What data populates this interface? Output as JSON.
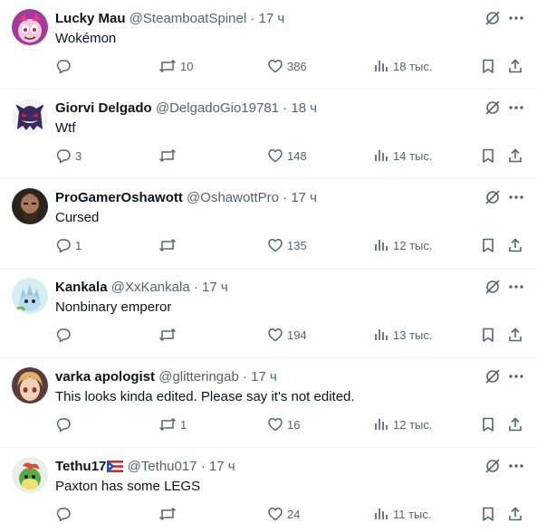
{
  "tweets": [
    {
      "name": "Lucky Mau",
      "handle": "@SteamboatSpinel",
      "sep": " · ",
      "time": "17 ч",
      "text": "Wokémon",
      "replies": "",
      "retweets": "10",
      "likes": "386",
      "views": "18 тыс.",
      "avatar_icon": "pink-cartoon-avatar",
      "flag": ""
    },
    {
      "name": "Giorvi Delgado",
      "handle": "@DelgadoGio19781",
      "sep": " · ",
      "time": "18 ч",
      "text": "Wtf",
      "replies": "3",
      "retweets": "",
      "likes": "148",
      "views": "14 тыс.",
      "avatar_icon": "purple-ghost-avatar",
      "flag": ""
    },
    {
      "name": "ProGamerOshawott",
      "handle": "@OshawottPro",
      "sep": " · ",
      "time": "17 ч",
      "text": "Cursed",
      "replies": "1",
      "retweets": "",
      "likes": "135",
      "views": "12 тыс.",
      "avatar_icon": "bearded-man-avatar",
      "flag": ""
    },
    {
      "name": "Kankala",
      "handle": "@XxKankala",
      "sep": " · ",
      "time": "17 ч",
      "text": "Nonbinary emperor",
      "replies": "",
      "retweets": "",
      "likes": "194",
      "views": "13 тыс.",
      "avatar_icon": "blue-creature-avatar",
      "flag": ""
    },
    {
      "name": "varka apologist",
      "handle": "@glitteringab",
      "sep": " · ",
      "time": "17 ч",
      "text": "This looks kinda edited. Please say it's not edited.",
      "replies": "",
      "retweets": "1",
      "likes": "16",
      "views": "12 тыс.",
      "avatar_icon": "anime-character-avatar",
      "flag": ""
    },
    {
      "name": "Tethu17",
      "handle": "@Tethu017",
      "sep": " · ",
      "time": "17 ч",
      "text": "Paxton has some LEGS",
      "replies": "",
      "retweets": "",
      "likes": "24",
      "views": "11 тыс.",
      "avatar_icon": "green-creature-avatar",
      "flag": "puerto-rico-flag-icon"
    }
  ],
  "colors": {
    "text": "#0f1419",
    "secondary": "#536471",
    "divider": "#eff3f4"
  }
}
